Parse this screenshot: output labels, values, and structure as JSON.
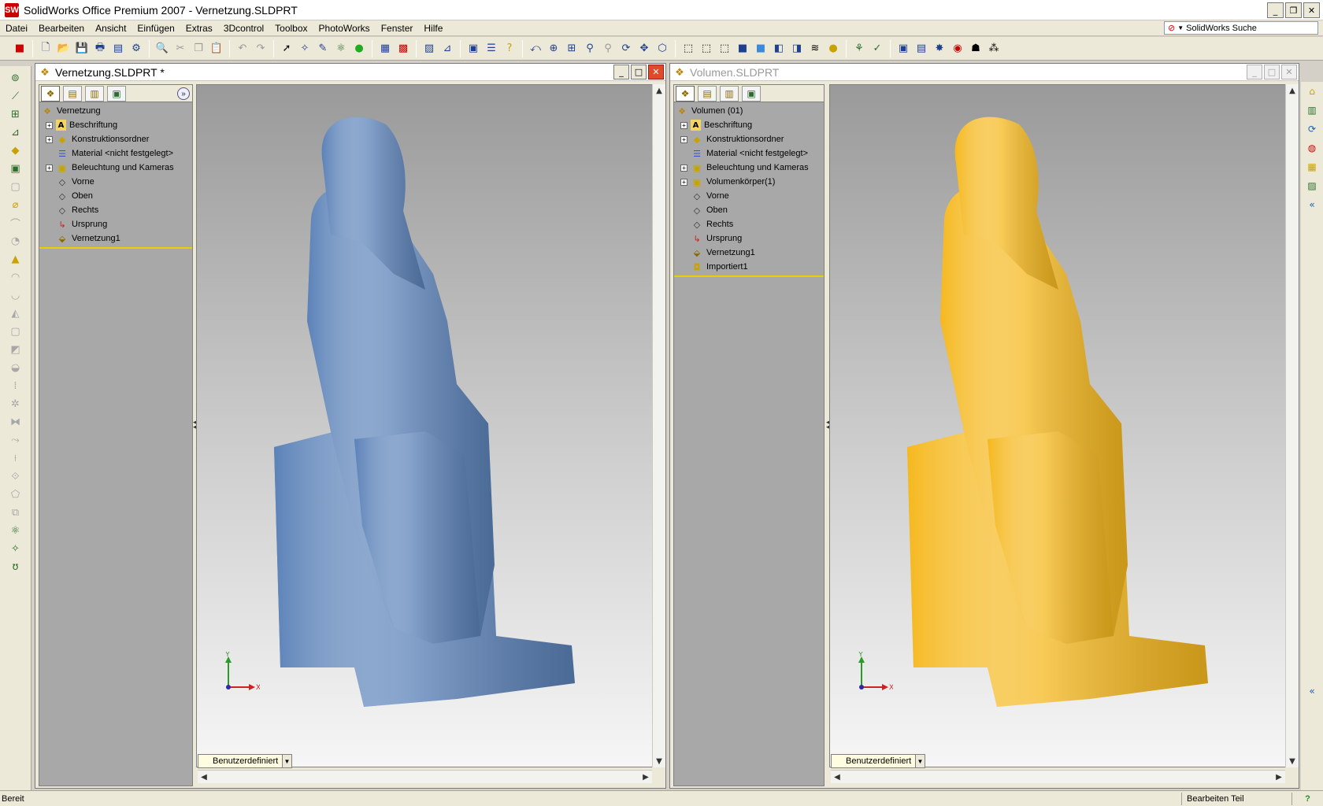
{
  "app": {
    "title": "SolidWorks Office Premium 2007 - Vernetzung.SLDPRT",
    "icon": "SW"
  },
  "menu": [
    "Datei",
    "Bearbeiten",
    "Ansicht",
    "Einfügen",
    "Extras",
    "3Dcontrol",
    "Toolbox",
    "PhotoWorks",
    "Fenster",
    "Hilfe"
  ],
  "search": {
    "label": "SolidWorks Suche"
  },
  "windows": [
    {
      "title": "Vernetzung.SLDPRT *",
      "tree": [
        {
          "label": "Vernetzung",
          "root": true,
          "icon": "part-icon"
        },
        {
          "label": "Beschriftung",
          "expand": true,
          "icon": "annotation-icon"
        },
        {
          "label": "Konstruktionsordner",
          "expand": true,
          "icon": "design-folder-icon"
        },
        {
          "label": "Material <nicht festgelegt>",
          "expand": false,
          "icon": "material-icon"
        },
        {
          "label": "Beleuchtung und Kameras",
          "expand": true,
          "icon": "lights-icon"
        },
        {
          "label": "Vorne",
          "expand": false,
          "icon": "plane-icon"
        },
        {
          "label": "Oben",
          "expand": false,
          "icon": "plane-icon"
        },
        {
          "label": "Rechts",
          "expand": false,
          "icon": "plane-icon"
        },
        {
          "label": "Ursprung",
          "expand": false,
          "icon": "origin-icon"
        },
        {
          "label": "Vernetzung1",
          "expand": false,
          "icon": "mesh-icon"
        }
      ],
      "view": "Benutzerdefiniert",
      "modelColor": "#5b82b8"
    },
    {
      "title": "Volumen.SLDPRT",
      "tree": [
        {
          "label": "Volumen  (01)",
          "root": true,
          "icon": "part-icon"
        },
        {
          "label": "Beschriftung",
          "expand": true,
          "icon": "annotation-icon"
        },
        {
          "label": "Konstruktionsordner",
          "expand": true,
          "icon": "design-folder-icon"
        },
        {
          "label": "Material <nicht festgelegt>",
          "expand": false,
          "icon": "material-icon"
        },
        {
          "label": "Beleuchtung und Kameras",
          "expand": true,
          "icon": "lights-icon"
        },
        {
          "label": "Volumenkörper(1)",
          "expand": true,
          "icon": "solid-bodies-icon"
        },
        {
          "label": "Vorne",
          "expand": false,
          "icon": "plane-icon"
        },
        {
          "label": "Oben",
          "expand": false,
          "icon": "plane-icon"
        },
        {
          "label": "Rechts",
          "expand": false,
          "icon": "plane-icon"
        },
        {
          "label": "Ursprung",
          "expand": false,
          "icon": "origin-icon"
        },
        {
          "label": "Vernetzung1",
          "expand": false,
          "icon": "mesh-icon"
        },
        {
          "label": "Importiert1",
          "expand": false,
          "icon": "imported-icon"
        }
      ],
      "view": "Benutzerdefiniert",
      "modelColor": "#f5b81e"
    }
  ],
  "triad": {
    "x": "X",
    "y": "Y"
  },
  "status": {
    "left": "Bereit",
    "right": "Bearbeiten Teil",
    "help": "?"
  }
}
